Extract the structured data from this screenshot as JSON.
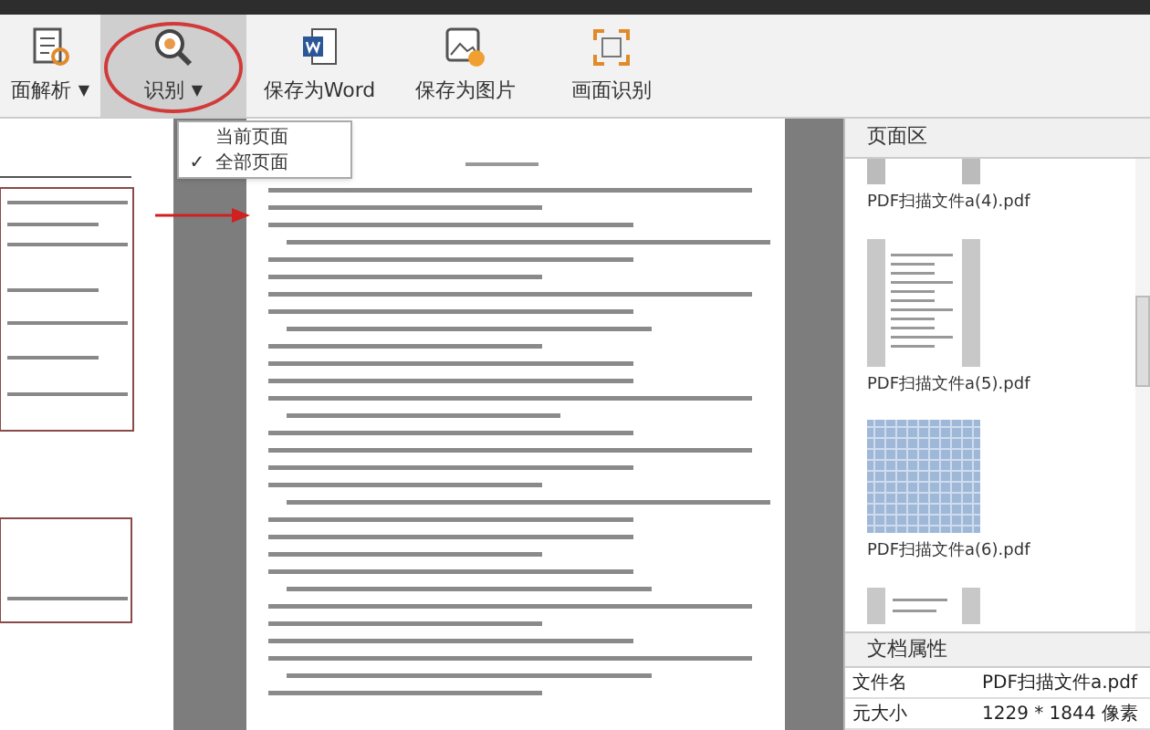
{
  "toolbar": {
    "buttons": [
      {
        "label": "面解析",
        "dropdown": "▼",
        "selected": false
      },
      {
        "label": "识别",
        "dropdown": "▼",
        "selected": true
      },
      {
        "label": "保存为Word",
        "selected": false
      },
      {
        "label": "保存为图片",
        "selected": false
      },
      {
        "label": "画面识别",
        "selected": false
      }
    ]
  },
  "menu": {
    "check_mark": "✓",
    "items": [
      {
        "label": "当前页面",
        "checked": false
      },
      {
        "label": "全部页面",
        "checked": true
      }
    ]
  },
  "page_panel": {
    "title": "页面区",
    "thumbnails": [
      {
        "label": "PDF扫描文件a(4).pdf",
        "kind": "partial"
      },
      {
        "label": "PDF扫描文件a(5).pdf",
        "kind": "text"
      },
      {
        "label": "PDF扫描文件a(6).pdf",
        "kind": "scan"
      },
      {
        "kind": "partial-bottom"
      }
    ]
  },
  "properties": {
    "title": "文档属性",
    "rows": [
      {
        "name": "文件名",
        "value": "PDF扫描文件a.pdf"
      },
      {
        "name": "元大小",
        "value": "1229 * 1844 像素"
      }
    ]
  }
}
